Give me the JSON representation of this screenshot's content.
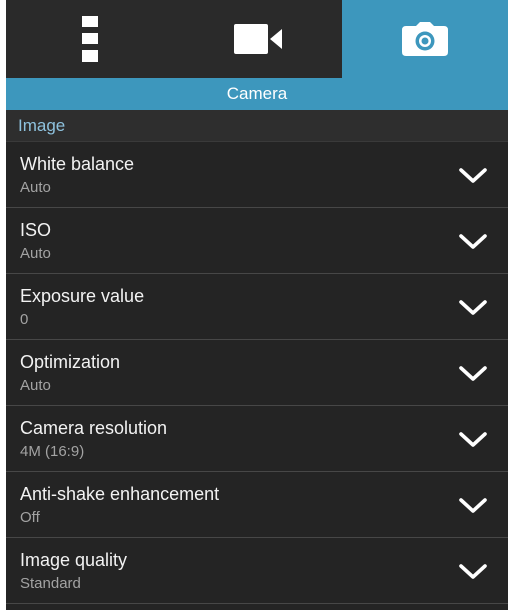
{
  "tabs": [
    {
      "icon": "settings-more-icon",
      "selected": false
    },
    {
      "icon": "video-camera-icon",
      "selected": false
    },
    {
      "icon": "camera-icon",
      "selected": true
    }
  ],
  "title": "Camera",
  "section": "Image",
  "settings": [
    {
      "label": "White balance",
      "value": "Auto"
    },
    {
      "label": "ISO",
      "value": "Auto"
    },
    {
      "label": "Exposure value",
      "value": "0"
    },
    {
      "label": "Optimization",
      "value": "Auto"
    },
    {
      "label": "Camera resolution",
      "value": "4M (16:9)"
    },
    {
      "label": "Anti-shake enhancement",
      "value": "Off"
    },
    {
      "label": "Image quality",
      "value": "Standard"
    }
  ],
  "colors": {
    "accent": "#3d97bd",
    "background": "#242424",
    "section_text": "#8ec2de"
  }
}
